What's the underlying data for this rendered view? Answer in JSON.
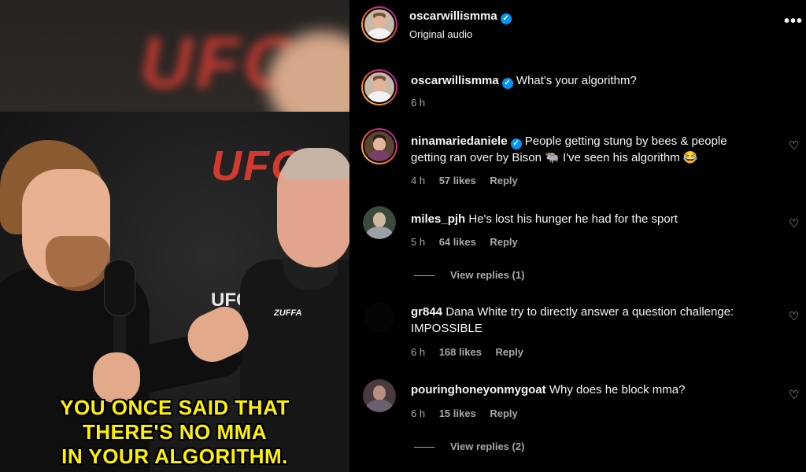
{
  "video": {
    "captions": [
      "YOU ONCE SAID THAT",
      "THERE'S NO MMA",
      "IN YOUR ALGORITHM."
    ],
    "caption_color": "#fff200",
    "brand_color": "#d23a2e"
  },
  "header": {
    "username": "oscarwillismma",
    "subtitle": "Original audio",
    "more_icon": "more-horizontal-icon"
  },
  "comments": [
    {
      "username": "oscarwillismma",
      "verified": true,
      "text": "What's your algorithm?",
      "time": "6 h",
      "likes": "",
      "reply": ""
    },
    {
      "username": "ninamariedaniele",
      "verified": true,
      "text_line1": "People getting stung by bees & people",
      "text_line2": "getting ran over by Bison 🐃 I've seen his algorithm 😂",
      "time": "4 h",
      "likes": "57 likes",
      "reply": "Reply"
    },
    {
      "username": "miles_pjh",
      "verified": false,
      "text": "He's lost his hunger he had for the sport",
      "time": "5 h",
      "likes": "64 likes",
      "reply": "Reply",
      "view_replies": "View replies (1)"
    },
    {
      "username": "gr844",
      "verified": false,
      "text_line1": "Dana White try to directly answer a question challenge:",
      "text_line2": "IMPOSSIBLE",
      "time": "6 h",
      "likes": "168 likes",
      "reply": "Reply"
    },
    {
      "username": "pouringhoneyonmygoat",
      "verified": false,
      "text": "Why does he block mma?",
      "time": "6 h",
      "likes": "15 likes",
      "reply": "Reply",
      "view_replies": "View replies (2)"
    }
  ],
  "brand": {
    "ufc_top": "UFC",
    "ufc_mid": "UFC",
    "ufc_small": "UFC",
    "zuffa": "ZUFFA"
  },
  "colors": {
    "verified": "#0095f6",
    "muted": "#a8a8a8",
    "background": "#000000"
  }
}
